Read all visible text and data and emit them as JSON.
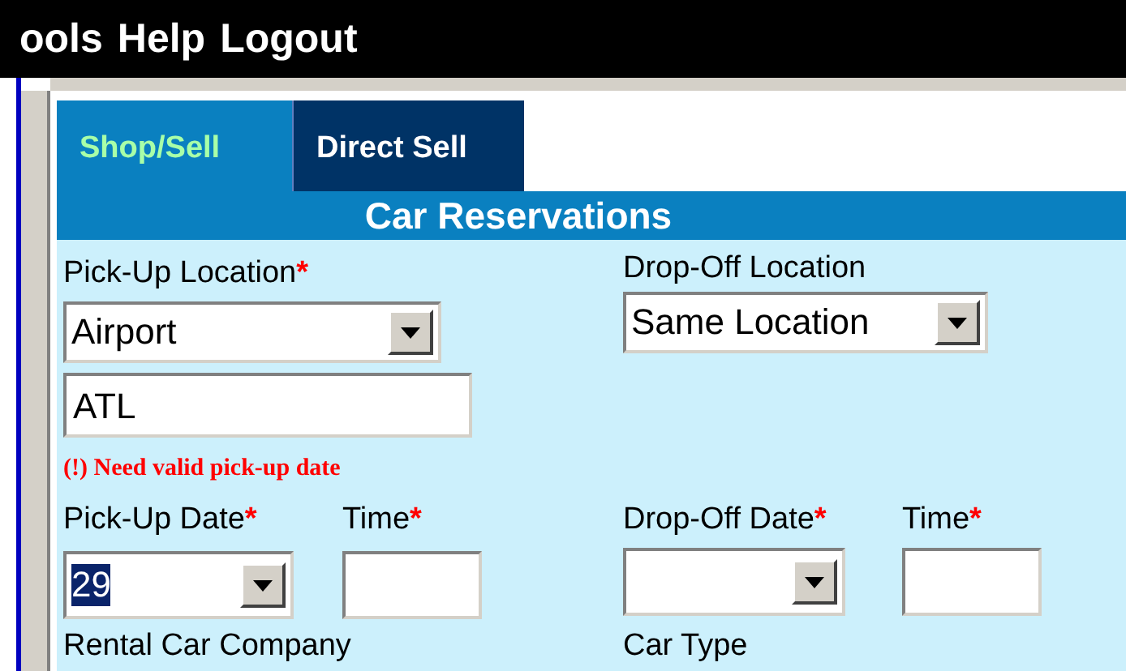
{
  "menu_bar": [
    "ools",
    "Help",
    "Logout"
  ],
  "tabs": [
    {
      "label": "Shop/Sell",
      "selected": true
    },
    {
      "label": "Direct Sell",
      "selected": false
    }
  ],
  "header": "Car Reservations",
  "pickup_location": {
    "label": "Pick-Up Location",
    "mark": "*",
    "value": "Airport",
    "code": "ATL"
  },
  "dropoff_location": {
    "label": "Drop-Off Location",
    "value": "Same Location"
  },
  "error": "(!) Need valid pick-up date",
  "pickup_date": {
    "label": "Pick-Up Date",
    "mark": "*",
    "value": "29",
    "highlighted": true
  },
  "pickup_time": {
    "label": "Time",
    "mark": "*"
  },
  "dropoff_date": {
    "label": "Drop-Off Date",
    "mark": "*"
  },
  "dropoff_time": {
    "label": "Time",
    "mark": "*"
  },
  "rental_company": {
    "label": "Rental Car Company"
  },
  "car_type": {
    "label": "Car Type"
  }
}
